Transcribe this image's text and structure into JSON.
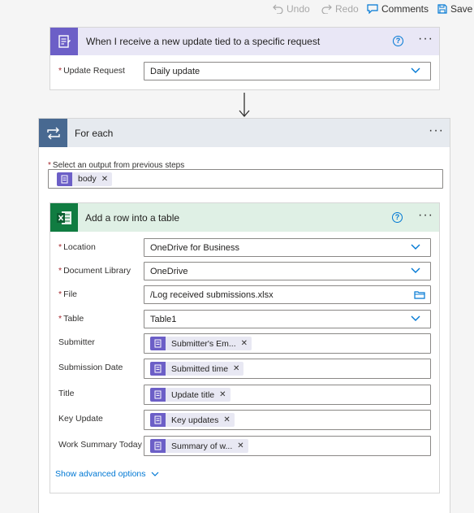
{
  "toolbar": {
    "undo": "Undo",
    "redo": "Redo",
    "comments": "Comments",
    "save": "Save"
  },
  "trigger": {
    "title": "When I receive a new update tied to a specific request",
    "fields": [
      {
        "label": "Update Request",
        "value": "Daily update",
        "required": true
      }
    ]
  },
  "foreach": {
    "title": "For each",
    "select_label": "Select an output from previous steps",
    "token": "body"
  },
  "action": {
    "title": "Add a row into a table",
    "fields": [
      {
        "label": "Location",
        "value": "OneDrive for Business"
      },
      {
        "label": "Document Library",
        "value": "OneDrive"
      },
      {
        "label": "File",
        "value": "/Log received submissions.xlsx"
      },
      {
        "label": "Table",
        "value": "Table1"
      },
      {
        "label": "Submitter",
        "token": "Submitter's Em..."
      },
      {
        "label": "Submission Date",
        "token": "Submitted time"
      },
      {
        "label": "Title",
        "token": "Update title"
      },
      {
        "label": "Key Update",
        "token": "Key updates"
      },
      {
        "label": "Work Summary Today",
        "token": "Summary of w..."
      }
    ],
    "advanced": "Show advanced options"
  },
  "colors": {
    "trigger_accent": "#6c5fc7",
    "foreach_accent": "#486991",
    "excel_accent": "#107c41",
    "link": "#0078d4"
  }
}
